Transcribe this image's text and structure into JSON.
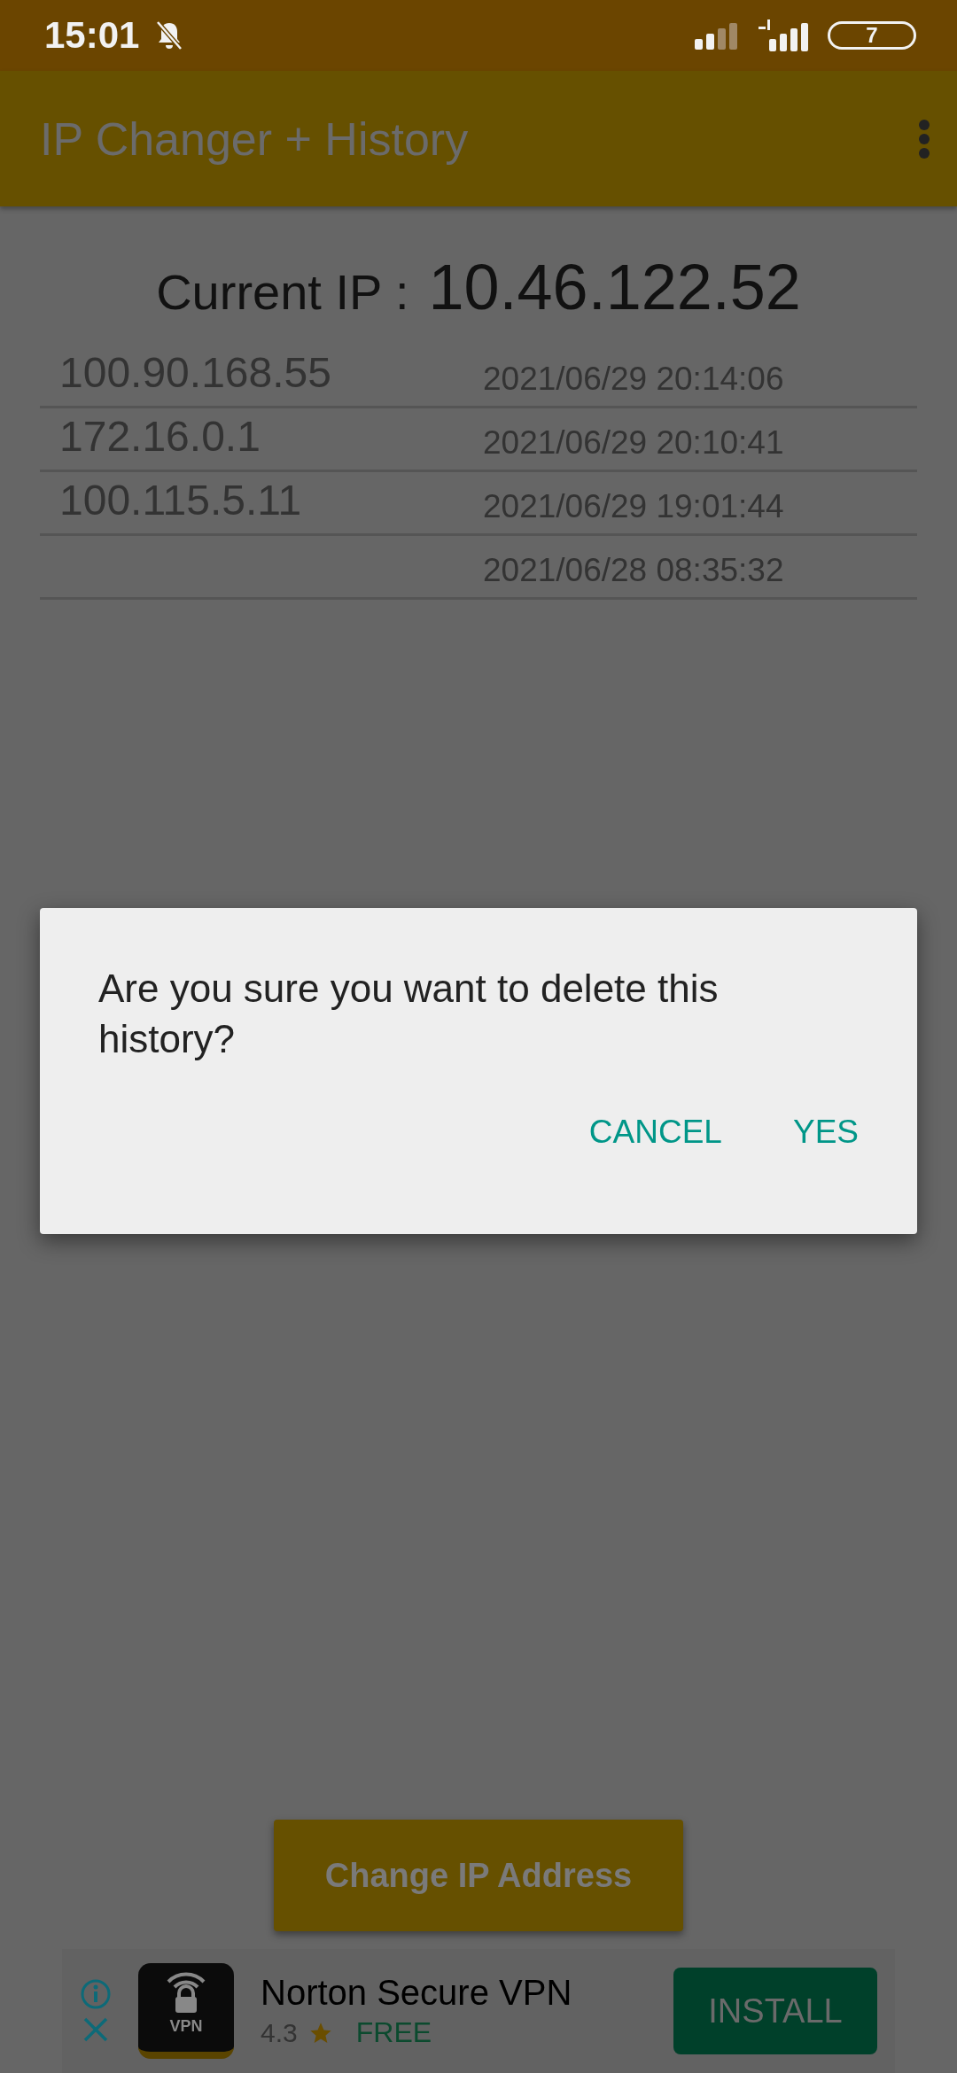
{
  "status_bar": {
    "time": "15:01",
    "battery": "7"
  },
  "app_bar": {
    "title": "IP Changer + History"
  },
  "current_ip": {
    "label": "Current IP :",
    "value": "10.46.122.52"
  },
  "history": [
    {
      "ip": "100.90.168.55",
      "time": "2021/06/29 20:14:06"
    },
    {
      "ip": "172.16.0.1",
      "time": "2021/06/29 20:10:41"
    },
    {
      "ip": "100.115.5.11",
      "time": "2021/06/29 19:01:44"
    },
    {
      "time": "2021/06/28 08:35:32"
    }
  ],
  "change_button": "Change IP Address",
  "ad": {
    "title": "Norton Secure VPN",
    "rating": "4.3",
    "price": "FREE",
    "button": "INSTALL",
    "icon_label": "VPN"
  },
  "dialog": {
    "message": "Are you sure you want to delete this history?",
    "buttons": [
      "CANCEL",
      "YES"
    ]
  }
}
